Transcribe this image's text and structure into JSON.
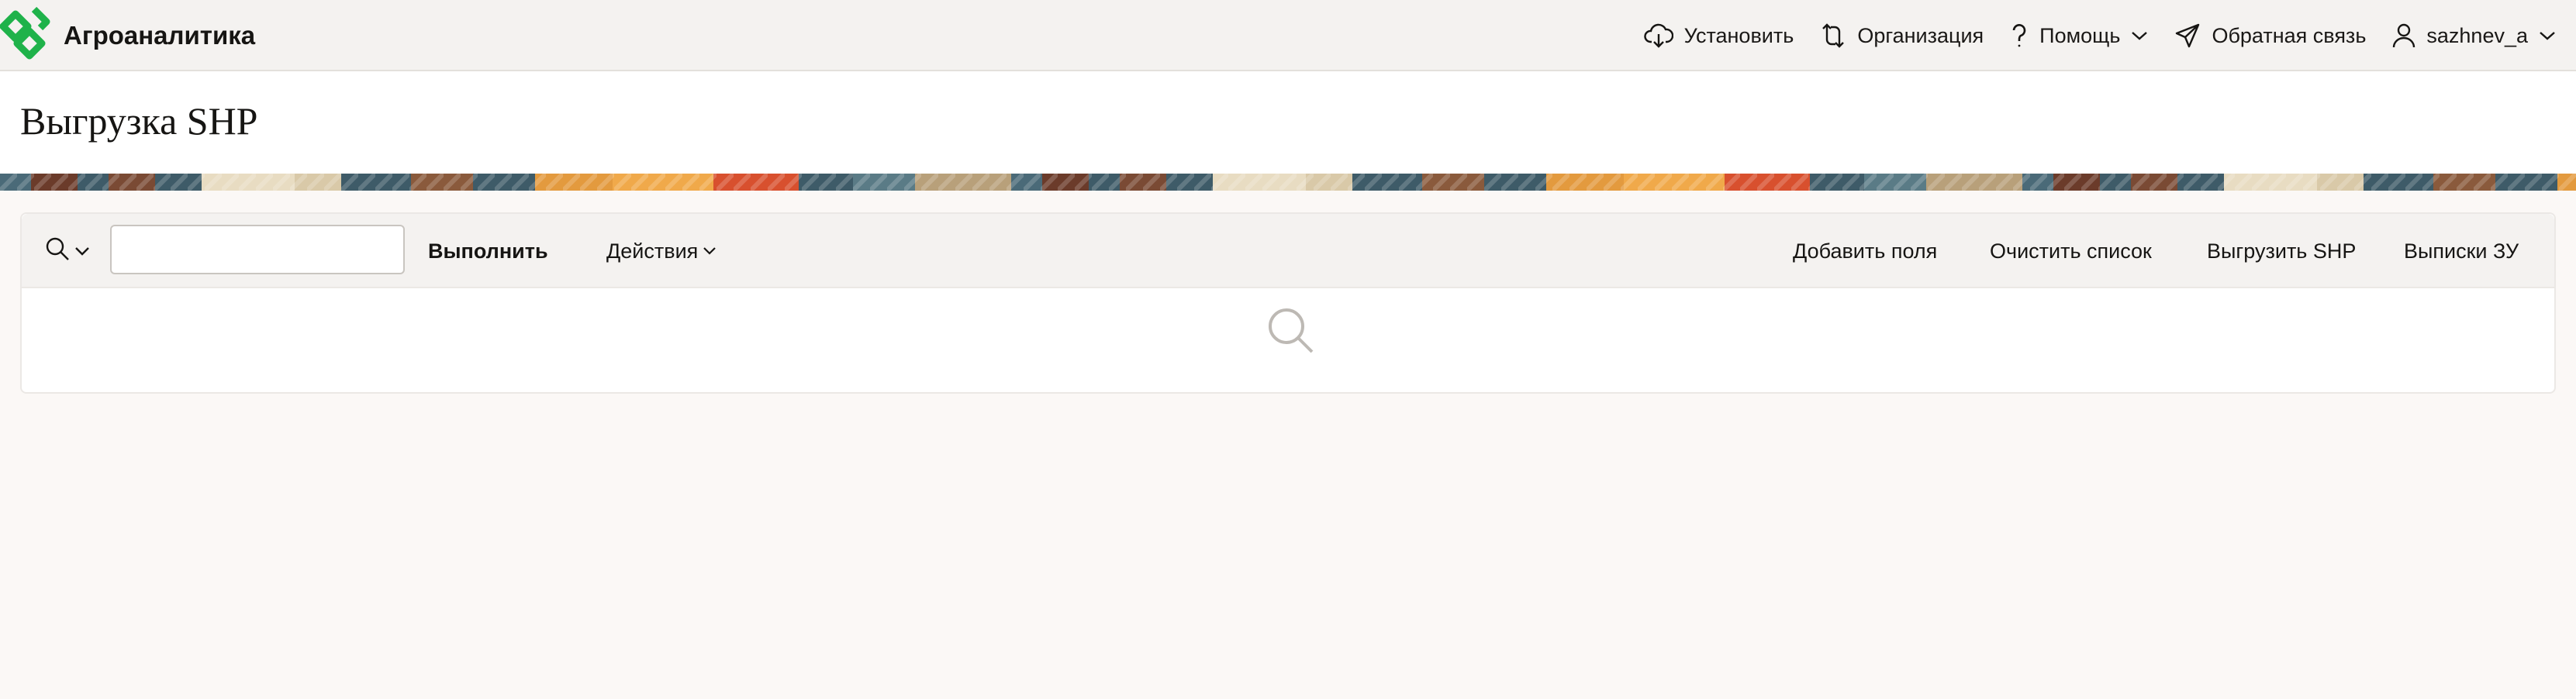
{
  "header": {
    "app_name": "Агроаналитика",
    "brand_color": "#1fb24a",
    "nav": {
      "install": "Установить",
      "organization": "Организация",
      "help": "Помощь",
      "feedback": "Обратная связь",
      "user": "sazhnev_a"
    }
  },
  "page": {
    "title": "Выгрузка SHP"
  },
  "toolbar": {
    "search_value": "",
    "run_label": "Выполнить",
    "actions_label": "Действия",
    "add_fields_label": "Добавить поля",
    "clear_list_label": "Очистить список",
    "export_shp_label": "Выгрузить SHP",
    "extracts_label": "Выписки ЗУ"
  },
  "icons": [
    "logo-icon",
    "cloud-download-icon",
    "swap-icon",
    "question-icon",
    "chevron-down-icon",
    "paper-plane-icon",
    "user-icon",
    "search-icon",
    "empty-search-icon"
  ]
}
